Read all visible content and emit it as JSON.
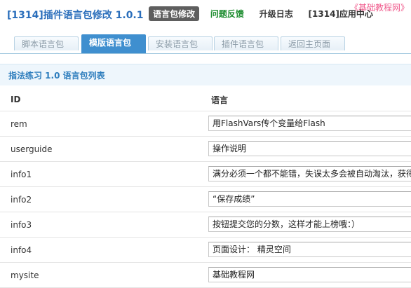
{
  "watermark": "《基础教程网》",
  "header": {
    "title": "[1314]插件语言包修改 1.0.1",
    "nav": [
      "语言包修改",
      "问题反馈",
      "升级日志",
      "[1314]应用中心"
    ]
  },
  "tabs": [
    "脚本语言包",
    "模版语言包",
    "安装语言包",
    "插件语言包",
    "返回主页面"
  ],
  "section_title": "指法练习 1.0 语言包列表",
  "table": {
    "columns": [
      "ID",
      "语言"
    ],
    "rows": [
      {
        "id": "rem",
        "value": "用FlashVars传个变量给Flash"
      },
      {
        "id": "userguide",
        "value": "操作说明"
      },
      {
        "id": "info1",
        "value": "满分必须一个都不能错，失误太多会被自动淘汰，获得"
      },
      {
        "id": "info2",
        "value": "“保存成绩”"
      },
      {
        "id": "info3",
        "value": "按钮提交您的分数，这样才能上榜哦：）"
      },
      {
        "id": "info4",
        "value": "页面设计： 精灵空间"
      },
      {
        "id": "mysite",
        "value": "基础教程网"
      }
    ]
  }
}
